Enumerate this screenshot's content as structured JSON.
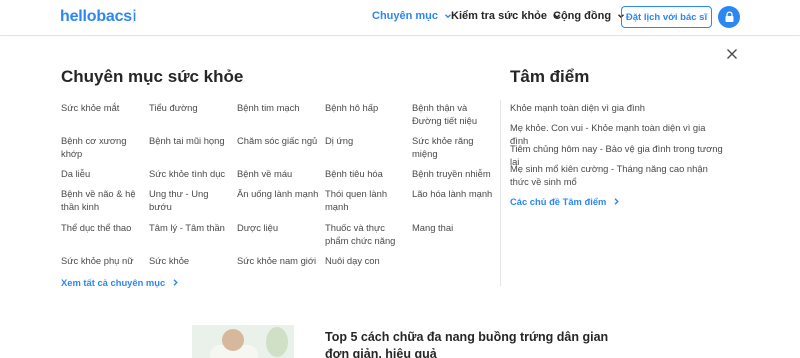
{
  "header": {
    "logo": "hellobacsi",
    "nav": [
      {
        "label": "Chuyên mục",
        "active": true
      },
      {
        "label": "Kiểm tra sức khỏe",
        "active": false
      },
      {
        "label": "Cộng đồng",
        "active": false
      }
    ],
    "book_button": "Đặt lịch với bác sĩ",
    "lock_icon": "lock-icon"
  },
  "menu": {
    "title": "Chuyên mục sức khỏe",
    "categories": [
      "Sức khỏe mắt",
      "Tiểu đường",
      "Bệnh tim mạch",
      "Bệnh hô hấp",
      "Bệnh thận và Đường tiết niệu",
      "Bệnh cơ xương khớp",
      "Bệnh tai mũi họng",
      "Chăm sóc giấc ngủ",
      "Dị ứng",
      "Sức khỏe răng miệng",
      "Da liễu",
      "Sức khỏe tình dục",
      "Bệnh về máu",
      "Bệnh tiêu hóa",
      "Bệnh truyền nhiễm",
      "Bệnh về não & hệ thần kinh",
      "Ung thư - Ung bướu",
      "Ăn uống lành mạnh",
      "Thói quen lành mạnh",
      "Lão hóa lành mạnh",
      "Thể dục thể thao",
      "Tâm lý - Tâm thần",
      "Dược liệu",
      "Thuốc và thực phẩm chức năng",
      "Mang thai",
      "Sức khỏe phụ nữ",
      "Sức khỏe",
      "Sức khỏe nam giới",
      "Nuôi dạy con"
    ],
    "see_all": "Xem tất cả chuyên mục",
    "highlight_title": "Tâm điểm",
    "highlights": [
      "Khỏe mạnh toàn diện vì gia đình",
      "Mẹ khỏe. Con vui - Khỏe mạnh toàn diện vì gia đình",
      "Tiêm chủng hôm nay - Bảo vệ gia đình trong tương lai",
      "Mẹ sinh mổ kiên cường - Tháng năng cao nhận thức về sinh mổ"
    ],
    "highlight_all": "Các chủ đề Tâm điểm",
    "close_icon": "close-icon"
  },
  "article": {
    "title": "Top 5 cách chữa đa nang buồng trứng dân gian đơn giản, hiệu quả"
  },
  "colors": {
    "accent": "#2d87f3",
    "text": "#262626",
    "muted": "#4a4a4a"
  }
}
